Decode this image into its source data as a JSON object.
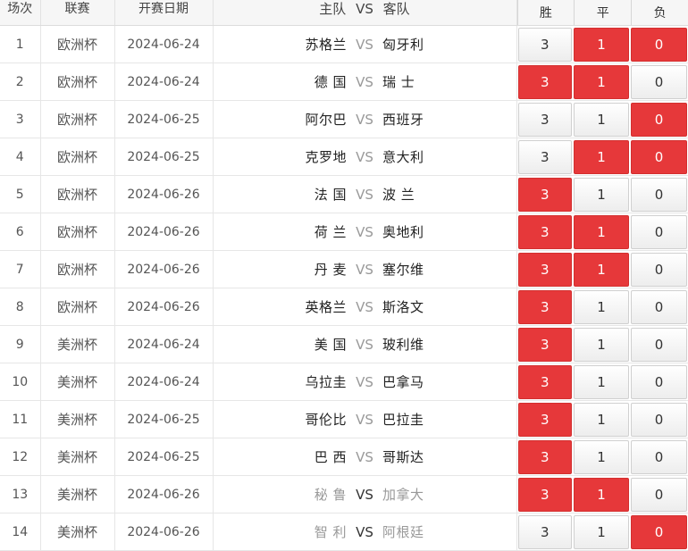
{
  "header": {
    "col_num": "场次",
    "col_league": "联赛",
    "col_date": "开赛日期",
    "col_home": "主队",
    "col_vs": "VS",
    "col_away": "客队",
    "odds_win": "胜",
    "odds_draw": "平",
    "odds_lose": "负"
  },
  "vs_label": "VS",
  "rows": [
    {
      "num": "1",
      "league": "欧洲杯",
      "date": "2024-06-24",
      "home": "苏格兰",
      "away": "匈牙利",
      "win": "3",
      "draw": "1",
      "lose": "0",
      "sel": [
        false,
        true,
        true
      ],
      "dim": false
    },
    {
      "num": "2",
      "league": "欧洲杯",
      "date": "2024-06-24",
      "home": "德 国",
      "away": "瑞 士",
      "win": "3",
      "draw": "1",
      "lose": "0",
      "sel": [
        true,
        true,
        false
      ],
      "dim": false
    },
    {
      "num": "3",
      "league": "欧洲杯",
      "date": "2024-06-25",
      "home": "阿尔巴",
      "away": "西班牙",
      "win": "3",
      "draw": "1",
      "lose": "0",
      "sel": [
        false,
        false,
        true
      ],
      "dim": false
    },
    {
      "num": "4",
      "league": "欧洲杯",
      "date": "2024-06-25",
      "home": "克罗地",
      "away": "意大利",
      "win": "3",
      "draw": "1",
      "lose": "0",
      "sel": [
        false,
        true,
        true
      ],
      "dim": false
    },
    {
      "num": "5",
      "league": "欧洲杯",
      "date": "2024-06-26",
      "home": "法 国",
      "away": "波 兰",
      "win": "3",
      "draw": "1",
      "lose": "0",
      "sel": [
        true,
        false,
        false
      ],
      "dim": false
    },
    {
      "num": "6",
      "league": "欧洲杯",
      "date": "2024-06-26",
      "home": "荷 兰",
      "away": "奥地利",
      "win": "3",
      "draw": "1",
      "lose": "0",
      "sel": [
        true,
        true,
        false
      ],
      "dim": false
    },
    {
      "num": "7",
      "league": "欧洲杯",
      "date": "2024-06-26",
      "home": "丹 麦",
      "away": "塞尔维",
      "win": "3",
      "draw": "1",
      "lose": "0",
      "sel": [
        true,
        true,
        false
      ],
      "dim": false
    },
    {
      "num": "8",
      "league": "欧洲杯",
      "date": "2024-06-26",
      "home": "英格兰",
      "away": "斯洛文",
      "win": "3",
      "draw": "1",
      "lose": "0",
      "sel": [
        true,
        false,
        false
      ],
      "dim": false
    },
    {
      "num": "9",
      "league": "美洲杯",
      "date": "2024-06-24",
      "home": "美 国",
      "away": "玻利维",
      "win": "3",
      "draw": "1",
      "lose": "0",
      "sel": [
        true,
        false,
        false
      ],
      "dim": false
    },
    {
      "num": "10",
      "league": "美洲杯",
      "date": "2024-06-24",
      "home": "乌拉圭",
      "away": "巴拿马",
      "win": "3",
      "draw": "1",
      "lose": "0",
      "sel": [
        true,
        false,
        false
      ],
      "dim": false
    },
    {
      "num": "11",
      "league": "美洲杯",
      "date": "2024-06-25",
      "home": "哥伦比",
      "away": "巴拉圭",
      "win": "3",
      "draw": "1",
      "lose": "0",
      "sel": [
        true,
        false,
        false
      ],
      "dim": false
    },
    {
      "num": "12",
      "league": "美洲杯",
      "date": "2024-06-25",
      "home": "巴 西",
      "away": "哥斯达",
      "win": "3",
      "draw": "1",
      "lose": "0",
      "sel": [
        true,
        false,
        false
      ],
      "dim": false
    },
    {
      "num": "13",
      "league": "美洲杯",
      "date": "2024-06-26",
      "home": "秘 鲁",
      "away": "加拿大",
      "win": "3",
      "draw": "1",
      "lose": "0",
      "sel": [
        true,
        true,
        false
      ],
      "dim": true
    },
    {
      "num": "14",
      "league": "美洲杯",
      "date": "2024-06-26",
      "home": "智 利",
      "away": "阿根廷",
      "win": "3",
      "draw": "1",
      "lose": "0",
      "sel": [
        false,
        false,
        true
      ],
      "dim": true
    }
  ]
}
